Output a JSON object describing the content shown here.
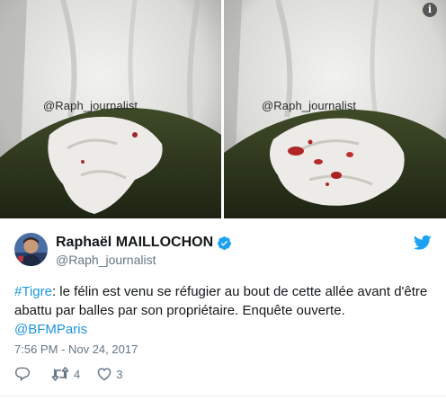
{
  "media": {
    "left_watermark": "@Raph_journalist",
    "right_watermark": "@Raph_journalist",
    "info_badge": "i"
  },
  "author": {
    "name": "Raphaël MAILLOCHON",
    "handle": "@Raph_journalist"
  },
  "tweet": {
    "hashtag": "#Tigre",
    "body_1": ": le félin est venu se réfugier au bout de cette allée avant d'être abattu par balles par son propriétaire. Enquête ouverte.",
    "mention": "@BFMParis",
    "timestamp": "7:56 PM - Nov 24, 2017"
  },
  "actions": {
    "retweets": "4",
    "likes": "3"
  },
  "colors": {
    "link": "#1b95e0",
    "verified": "#1da1f2",
    "muted": "#657786"
  }
}
